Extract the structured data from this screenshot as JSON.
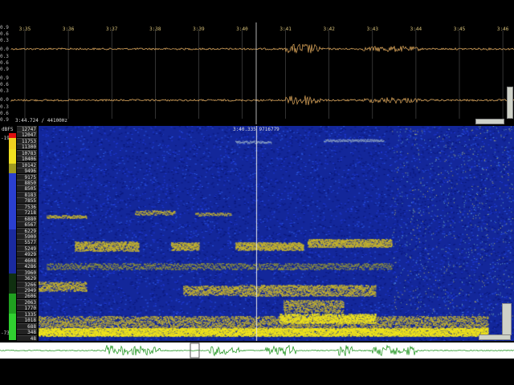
{
  "waveform": {
    "time_labels": [
      "3:35",
      "3:36",
      "3:37",
      "3:38",
      "3:39",
      "3:40",
      "3:41",
      "3:42",
      "3:43",
      "3:44",
      "3:45",
      "3:46"
    ],
    "amp_labels": [
      "0.9",
      "0.6",
      "0.3",
      "0.0",
      "0.3",
      "0.6",
      "0.9",
      "0.9",
      "0.6",
      "0.3",
      "0.0",
      "0.3",
      "0.6",
      "0.9"
    ],
    "status": "3:44.724 / 44100Hz",
    "wave_color": "#e0a85a",
    "grid_color": "#555555"
  },
  "spectrogram": {
    "cursor_readout": "3:40.335  9716779",
    "db_unit": "dBFS",
    "db_top": "-19",
    "db_bottom": "-73",
    "freq_labels": [
      "12747",
      "12047",
      "11753",
      "11300",
      "10783",
      "10406",
      "10142",
      "9496",
      "9175",
      "8850",
      "8505",
      "8183",
      "7855",
      "7536",
      "7218",
      "6880",
      "6567",
      "6229",
      "5900",
      "5577",
      "5249",
      "4929",
      "4608",
      "4286",
      "3960",
      "3629",
      "3266",
      "2949",
      "2606",
      "2063",
      "1770",
      "1335",
      "1018",
      "688",
      "348",
      "48"
    ],
    "palette": {
      "low": "#0a1a8a",
      "mid": "#1d3fd6",
      "high": "#c9b62a",
      "peak": "#f2e61a"
    }
  },
  "colorbar": [
    "#d01010",
    "#f0d020",
    "#f0d020",
    "#b0a020",
    "#2a3fd0",
    "#1a2aa0",
    "#20b020",
    "#30d030"
  ],
  "overview": {
    "wave_color": "#2a9a2a"
  }
}
